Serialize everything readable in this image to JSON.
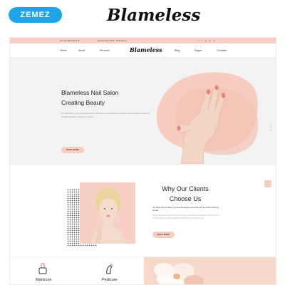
{
  "marketplace": {
    "brand": "ZEMEZ",
    "product_title": "Blameless"
  },
  "site": {
    "topbar": {
      "phone": "Free call: (800) 123 56 78",
      "hours": "Opening Hours: 08:00 - 18:00 Sat-Sun",
      "social_icons": [
        "facebook-icon",
        "twitter-icon",
        "google-plus-icon",
        "instagram-icon",
        "pinterest-icon"
      ]
    },
    "nav": {
      "home": "Home",
      "about": "About",
      "services": "Services",
      "logo": "Blameless",
      "blog": "Blog",
      "pages": "Pages",
      "contacts": "Contacts"
    },
    "hero": {
      "title_line1": "Blameless Nail Salon",
      "title_line2": "Creating Beauty",
      "text": "Our Nail Salon is top unique and various nail designs to all customers of all ages. We are a team of talented professionals with a passion for nail art",
      "button": "READ MORE",
      "side_label": "01 / 03"
    },
    "about": {
      "title_line1": "Why Our Clients",
      "title_line2": "Choose Us",
      "lead": "Our salon aims to deliver the best nail design experience and top-notch customer service.",
      "text": "We use advanced products and technology to provide the best treatments for our clients. Our nail artists are highly qualified and will help you choose the style",
      "button": "READ MORE"
    },
    "services": [
      {
        "label": "Manicure",
        "icon": "nail-polish-icon"
      },
      {
        "label": "Pedicure",
        "icon": "foot-icon"
      }
    ],
    "colors": {
      "accent": "#f7cdc0",
      "brand_badge": "#1fa4e8",
      "background": "#f3f3f3"
    }
  }
}
